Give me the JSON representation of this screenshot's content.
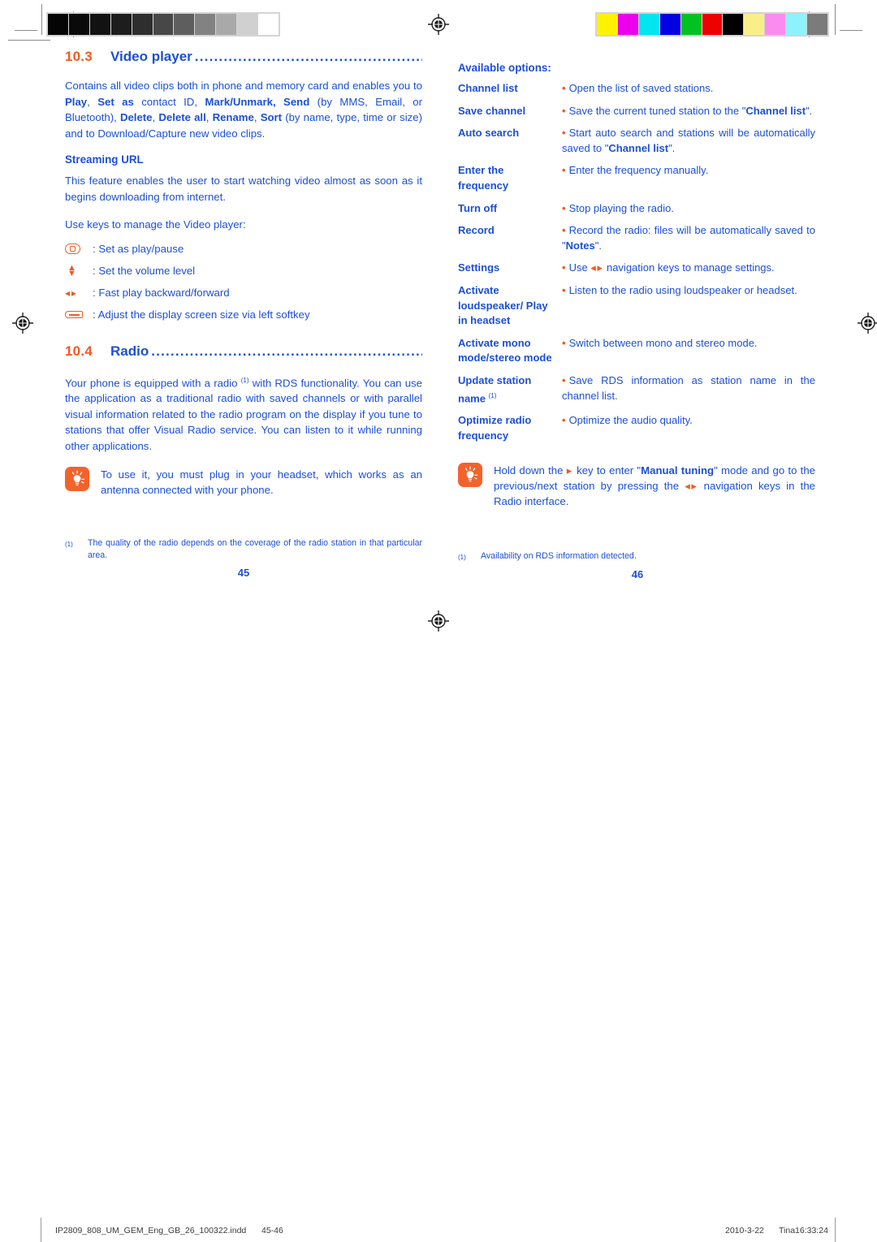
{
  "document": {
    "slug_filename": "IP2809_808_UM_GEM_Eng_GB_26_100322.indd",
    "slug_pages": "45-46",
    "slug_date": "2010-3-22",
    "slug_operator": "Tina16:33:24"
  },
  "colors": {
    "accent_orange": "#f15a22",
    "body_blue": "#1c4fd8",
    "tip_icon_bg": "#f4622b",
    "strip_frame": "#d4d4d4"
  },
  "print_marks": {
    "gray_strip_label": "grayscale-step-wedge",
    "gray_patches": [
      "#050505",
      "#0a0a0a",
      "#121212",
      "#1d1d1d",
      "#2e2e2e",
      "#474747",
      "#5e5e5e",
      "#828282",
      "#a9a9a9",
      "#d0d0d0",
      "#ffffff"
    ],
    "color_strip_label": "process-color-control-bar",
    "color_patches": [
      "#fff200",
      "#ec00ec",
      "#00e5f0",
      "#0000e0",
      "#00c322",
      "#ed0000",
      "#000000",
      "#faee88",
      "#fc8bf0",
      "#8df2fb",
      "#7b7b7b"
    ],
    "registration_mark_label": "registration-target"
  },
  "left_page": {
    "section": {
      "number": "10.3",
      "title": "Video player",
      "dots": "......................................................"
    },
    "intro_html": "Contains all video clips both in phone and memory card and enables you to <b>Play</b>, <b>Set as</b> contact ID, <b>Mark/Unmark, Send</b> (by MMS, Email, or Bluetooth), <b>Delete</b>, <b>Delete all</b>, <b>Rename</b>, <b>Sort</b> (by name, type, time or size) and to Download/Capture new video clips.",
    "streaming_heading": "Streaming URL",
    "streaming_body": "This feature enables the user to start watching video almost as soon as it begins downloading from internet.",
    "keys_intro": "Use keys to manage the Video player:",
    "key_rows": [
      {
        "icon": "ok-key-icon",
        "label": ": Set as play/pause"
      },
      {
        "icon": "up-down-key-icon",
        "label": ": Set the volume level"
      },
      {
        "icon": "left-right-key-icon",
        "label": ": Fast play backward/forward"
      },
      {
        "icon": "left-softkey-icon",
        "label": ": Adjust the display screen size via left softkey"
      }
    ],
    "section2": {
      "number": "10.4",
      "title": "Radio",
      "dots": "............................................................"
    },
    "radio_body_html": "Your phone is equipped with a radio <sup class=\"fn\">(1)</sup> with RDS functionality. You can use the application as a traditional radio with saved channels or with parallel visual information related to the radio program on the display if you tune to stations that offer Visual Radio service. You can listen to it while running other applications.",
    "tip_text": "To use it, you must plug in your headset, which works as an antenna connected with your phone.",
    "footnote_mark": "(1)",
    "footnote_text": "The quality of the radio depends on the coverage of the radio station in that particular area.",
    "folio": "45"
  },
  "right_page": {
    "available_options_heading": "Available options:",
    "options": [
      {
        "term": "Channel list",
        "desc_html": "Open the list of saved stations."
      },
      {
        "term": "Save channel",
        "desc_html": "Save the current tuned station to the \"<b>Channel list</b>\"."
      },
      {
        "term": "Auto search",
        "desc_html": "Start auto search and stations will be automatically saved to \"<b>Channel list</b>\"."
      },
      {
        "term": "Enter the frequency",
        "desc_html": "Enter the frequency manually."
      },
      {
        "term": "Turn off",
        "desc_html": "Stop playing the radio."
      },
      {
        "term": "Record",
        "desc_html": "Record the radio: files will be automatically saved to \"<b>Notes</b>\"."
      },
      {
        "term": "Settings",
        "desc_html": "Use <span class=\"navglyph\">&#9666;&#9656;</span> navigation keys to manage settings."
      },
      {
        "term": "Activate loudspeaker/ Play in headset",
        "desc_html": "Listen to the radio using loudspeaker or headset."
      },
      {
        "term": "Activate mono mode/stereo mode",
        "desc_html": "Switch between mono and stereo mode."
      },
      {
        "term_html": "Update station name <sup class=\"fn\">(1)</sup>",
        "term": "Update station name (1)",
        "desc_html": "Save RDS information as station name in the channel list."
      },
      {
        "term": "Optimize radio frequency",
        "desc_html": "Optimize the audio quality."
      }
    ],
    "tip_text_html": "Hold down the <span class=\"navglyph\">&#9656;</span> key to enter \"<b>Manual tuning</b>\" mode and go to the previous/next station by pressing the <span class=\"navglyph\">&#9666;&#9656;</span> navigation keys in the Radio interface.",
    "footnote_mark": "(1)",
    "footnote_text": "Availability on RDS information detected.",
    "folio": "46"
  }
}
